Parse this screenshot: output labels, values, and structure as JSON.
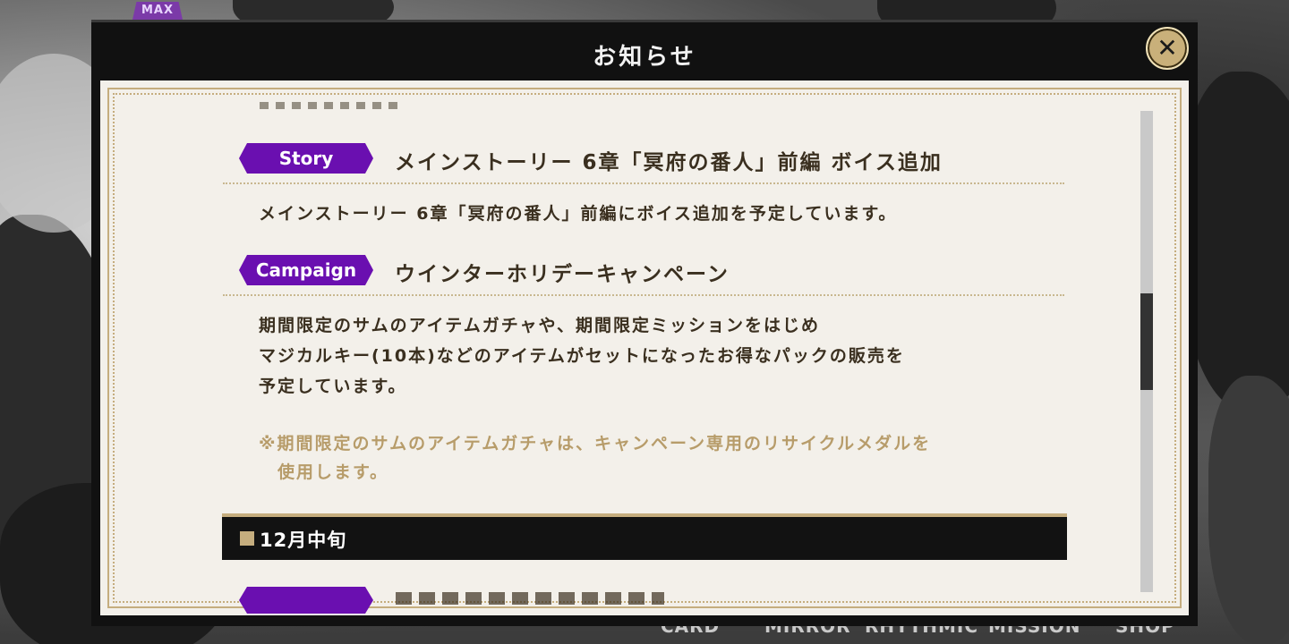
{
  "background": {
    "badge": "MAX",
    "nav": [
      "CARD",
      "MIRROR",
      "RHYTHMIC",
      "MISSION",
      "SHOP"
    ]
  },
  "dialog": {
    "title": "お知らせ",
    "close_icon": "close-x-icon"
  },
  "notices": [
    {
      "tag": "Story",
      "title": "メインストーリー 6章「冥府の番人」前編 ボイス追加",
      "body": [
        "メインストーリー 6章「冥府の番人」前編にボイス追加を予定しています。"
      ]
    },
    {
      "tag": "Campaign",
      "title": "ウインターホリデーキャンペーン",
      "body": [
        "期間限定のサムのアイテムガチャや、期間限定ミッションをはじめ",
        "マジカルキー(10本)などのアイテムがセットになったお得なパックの販売を",
        "予定しています。"
      ],
      "note": [
        "※期間限定のサムのアイテムガチャは、キャンペーン専用のリサイクルメダルを",
        "　使用します。"
      ]
    }
  ],
  "section": {
    "label": "12月中旬"
  },
  "colors": {
    "tag_purple": "#6a0fb0",
    "gold": "#c5ad7e",
    "paper": "#f3f0ea",
    "note_text": "#b79c6a"
  }
}
